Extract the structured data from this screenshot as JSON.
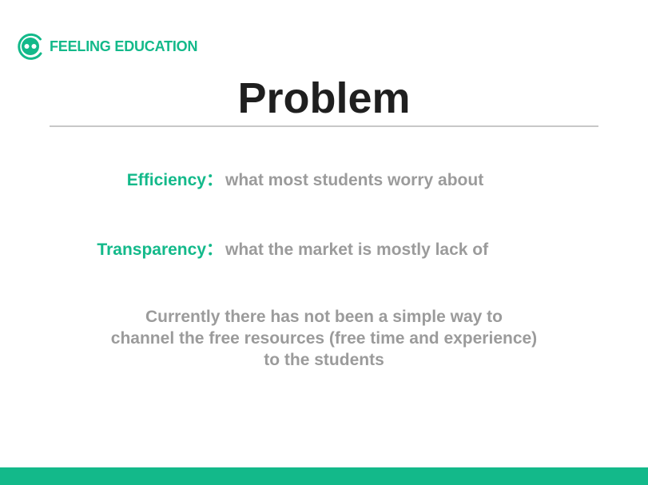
{
  "brand": {
    "name": "FEELING EDUCATION",
    "logo_icon": "smiley-face-logo",
    "color": "#13b98a"
  },
  "slide": {
    "title": "Problem",
    "points": [
      {
        "term": "Efficiency",
        "separator": "：",
        "description": "what most students worry about"
      },
      {
        "term": "Transparency",
        "separator": "：",
        "description": "what the market is mostly lack of"
      }
    ],
    "statement": [
      "Currently there has not been a simple way to",
      "channel the free resources (free time and experience)",
      "to the students"
    ]
  },
  "colors": {
    "accent": "#13b98a",
    "title": "#1f1f1f",
    "body": "#9b9b9b",
    "divider": "#c8c8c8"
  }
}
